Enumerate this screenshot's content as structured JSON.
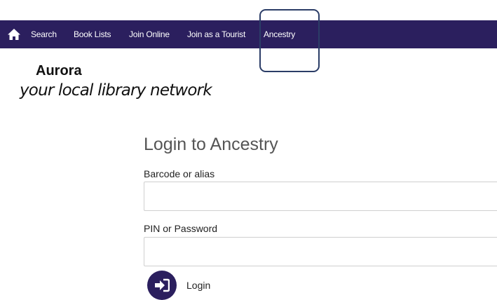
{
  "nav": {
    "home_icon": "home-icon",
    "items": [
      {
        "label": "Search"
      },
      {
        "label": "Book Lists"
      },
      {
        "label": "Join Online"
      },
      {
        "label": "Join as a Tourist"
      },
      {
        "label": "Ancestry"
      }
    ]
  },
  "logo": {
    "title": "Aurora",
    "tagline": "your local library network"
  },
  "login": {
    "title": "Login to Ancestry",
    "barcode_label": "Barcode or alias",
    "barcode_value": "",
    "password_label": "PIN or Password",
    "password_value": "",
    "button_label": "Login",
    "button_icon": "sign-in-icon"
  },
  "colors": {
    "navbar_bg": "#2b1f5e",
    "highlight_border": "#2b3d67"
  }
}
